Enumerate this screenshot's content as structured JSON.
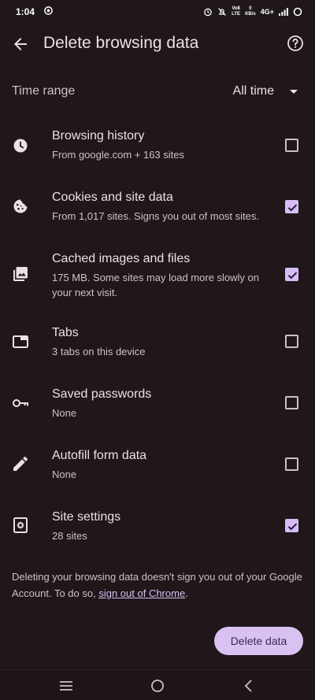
{
  "status_bar": {
    "time": "1:04",
    "network": "4G+",
    "speed_value": "0",
    "speed_unit": "KB/s",
    "volte_top": "Vo8",
    "volte_bottom": "LTE"
  },
  "header": {
    "title": "Delete browsing data"
  },
  "time_range": {
    "label": "Time range",
    "value": "All time"
  },
  "items": [
    {
      "title": "Browsing history",
      "subtitle": "From google.com + 163 sites",
      "checked": false,
      "icon": "history-clock-icon"
    },
    {
      "title": "Cookies and site data",
      "subtitle": "From 1,017 sites. Signs you out of most sites.",
      "checked": true,
      "icon": "cookie-icon"
    },
    {
      "title": "Cached images and files",
      "subtitle": "175 MB. Some sites may load more slowly on your next visit.",
      "checked": true,
      "icon": "image-library-icon"
    },
    {
      "title": "Tabs",
      "subtitle": "3 tabs on this device",
      "checked": false,
      "icon": "tab-icon"
    },
    {
      "title": "Saved passwords",
      "subtitle": "None",
      "checked": false,
      "icon": "key-icon"
    },
    {
      "title": "Autofill form data",
      "subtitle": "None",
      "checked": false,
      "icon": "pencil-icon"
    },
    {
      "title": "Site settings",
      "subtitle": "28 sites",
      "checked": true,
      "icon": "site-settings-icon"
    }
  ],
  "footer": {
    "note_prefix": "Deleting your browsing data doesn't sign you out of your Google Account. To do so, ",
    "link_text": "sign out of Chrome",
    "note_suffix": "."
  },
  "actions": {
    "delete_label": "Delete data"
  },
  "colors": {
    "background": "#1f1719",
    "accent": "#d6bdf5",
    "button_bg": "#d9c2f2",
    "button_text": "#3b2b55"
  }
}
